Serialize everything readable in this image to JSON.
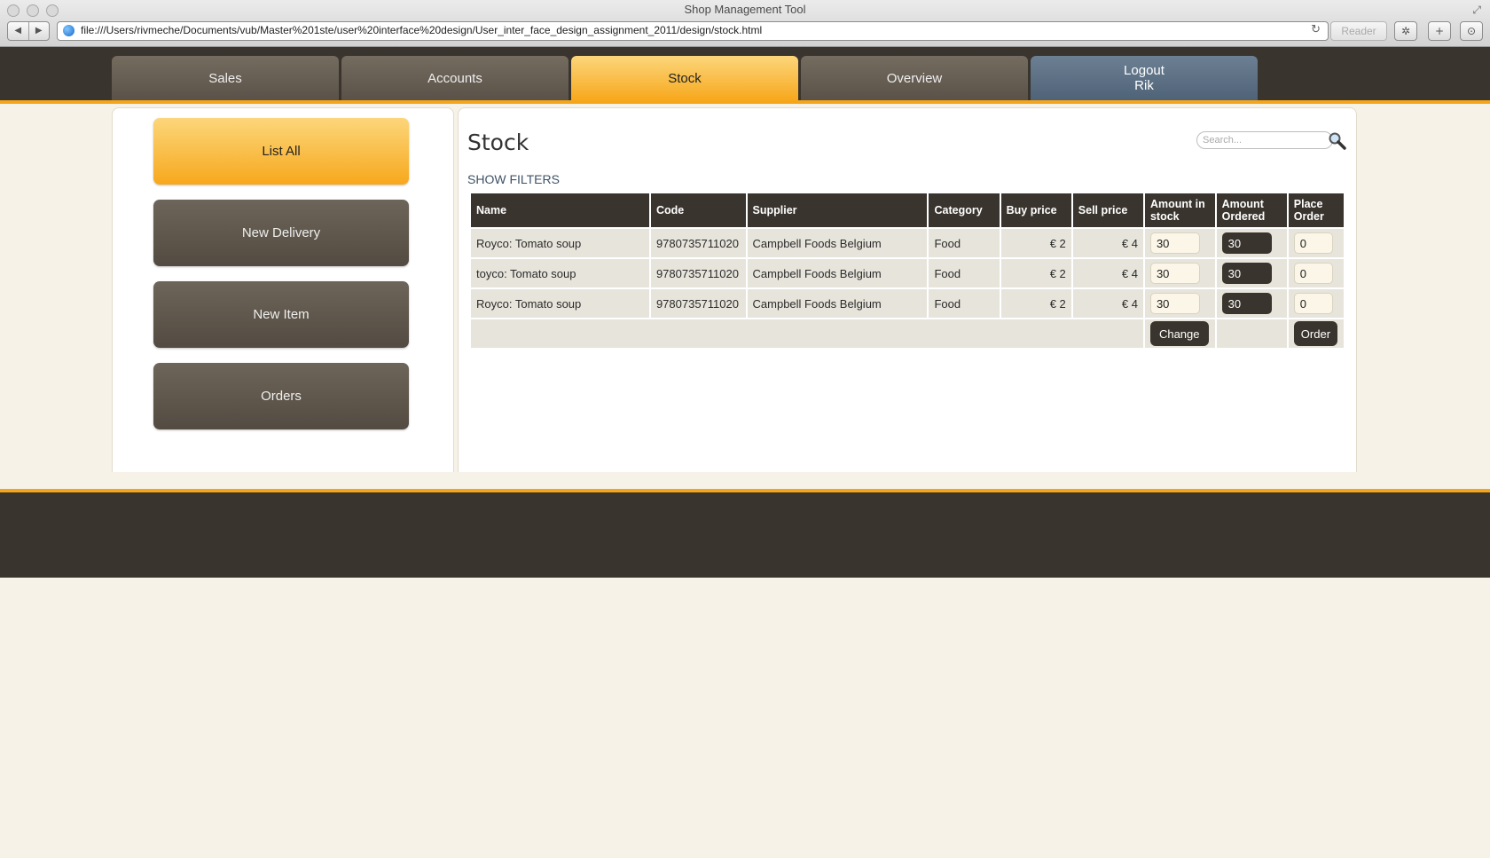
{
  "browser": {
    "window_title": "Shop Management Tool",
    "url": "file:///Users/rivmeche/Documents/vub/Master%201ste/user%20interface%20design/User_inter_face_design_assignment_2011/design/stock.html",
    "reader_label": "Reader"
  },
  "nav": {
    "tabs": [
      {
        "label": "Sales"
      },
      {
        "label": "Accounts"
      },
      {
        "label": "Stock"
      },
      {
        "label": "Overview"
      }
    ],
    "logout_label": "Logout",
    "user_name": "Rik"
  },
  "sidebar": {
    "items": [
      {
        "label": "List All"
      },
      {
        "label": "New Delivery"
      },
      {
        "label": "New Item"
      },
      {
        "label": "Orders"
      }
    ]
  },
  "main": {
    "title": "Stock",
    "filters_link": "SHOW FILTERS",
    "search_placeholder": "Search...",
    "table": {
      "headers": {
        "name": "Name",
        "code": "Code",
        "supplier": "Supplier",
        "category": "Category",
        "buy": "Buy price",
        "sell": "Sell price",
        "stock_l1": "Amount in",
        "stock_l2": "stock",
        "ordered_l1": "Amount",
        "ordered_l2": "Ordered",
        "place_l1": "Place",
        "place_l2": "Order"
      },
      "rows": [
        {
          "name": "Royco: Tomato soup",
          "code": "9780735711020",
          "supplier": "Campbell Foods Belgium",
          "category": "Food",
          "buy": "€ 2",
          "sell": "€ 4",
          "stock": "30",
          "ordered": "30",
          "order": "0"
        },
        {
          "name": "toyco: Tomato soup",
          "code": "9780735711020",
          "supplier": "Campbell Foods Belgium",
          "category": "Food",
          "buy": "€ 2",
          "sell": "€ 4",
          "stock": "30",
          "ordered": "30",
          "order": "0"
        },
        {
          "name": "Royco: Tomato soup",
          "code": "9780735711020",
          "supplier": "Campbell Foods Belgium",
          "category": "Food",
          "buy": "€ 2",
          "sell": "€ 4",
          "stock": "30",
          "ordered": "30",
          "order": "0"
        }
      ],
      "change_label": "Change",
      "order_label": "Order"
    }
  },
  "colors": {
    "accent": "#f7a81c",
    "dark": "#3a342e",
    "background": "#f7f2e7"
  }
}
